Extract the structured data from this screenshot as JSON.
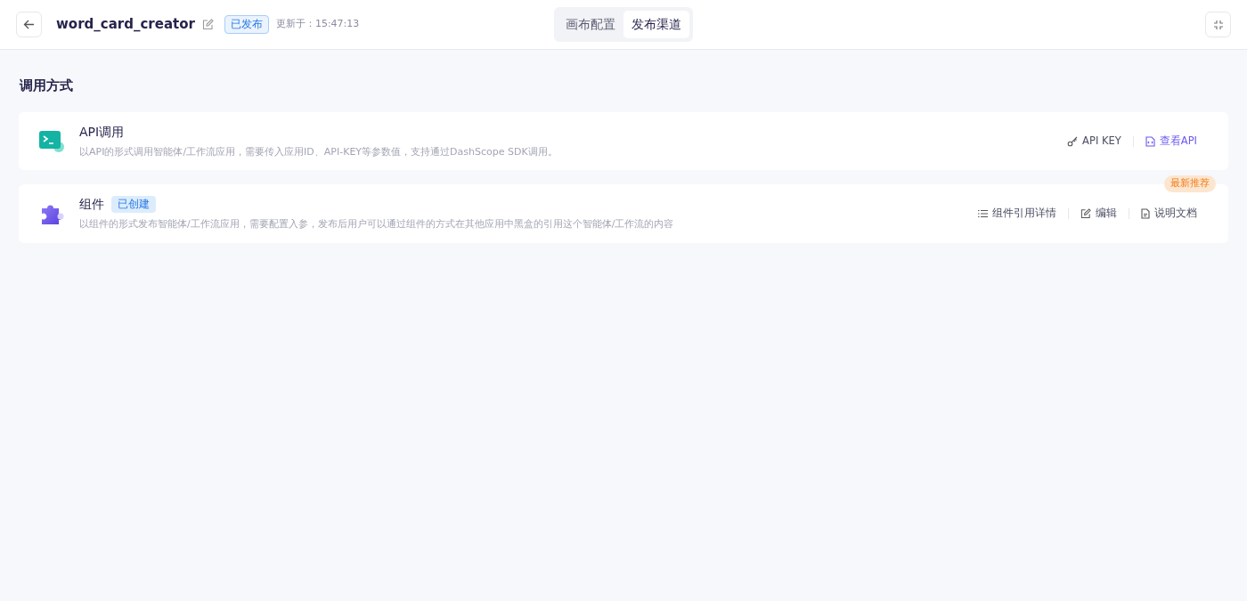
{
  "header": {
    "title": "word_card_creator",
    "status": "已发布",
    "updated": "更新于：15:47:13"
  },
  "tabs": [
    {
      "label": "画布配置",
      "selected": false
    },
    {
      "label": "发布渠道",
      "selected": true
    }
  ],
  "section_title": "调用方式",
  "methods": [
    {
      "kind": "api",
      "title": "API调用",
      "description": "以API的形式调用智能体/工作流应用，需要传入应用ID、API-KEY等参数值，支持通过DashScope SDK调用。",
      "actions": [
        {
          "kind": "key",
          "label": "API KEY"
        },
        {
          "kind": "view",
          "label": "查看API"
        }
      ]
    },
    {
      "kind": "component",
      "title": "组件",
      "badge": "已创建",
      "ribbon": "最新推荐",
      "description": "以组件的形式发布智能体/工作流应用，需要配置入参，发布后用户可以通过组件的方式在其他应用中黑盒的引用这个智能体/工作流的内容",
      "actions": [
        {
          "kind": "usage",
          "label": "组件引用详情"
        },
        {
          "kind": "edit",
          "label": "编辑"
        },
        {
          "kind": "docs",
          "label": "说明文档"
        }
      ]
    }
  ]
}
